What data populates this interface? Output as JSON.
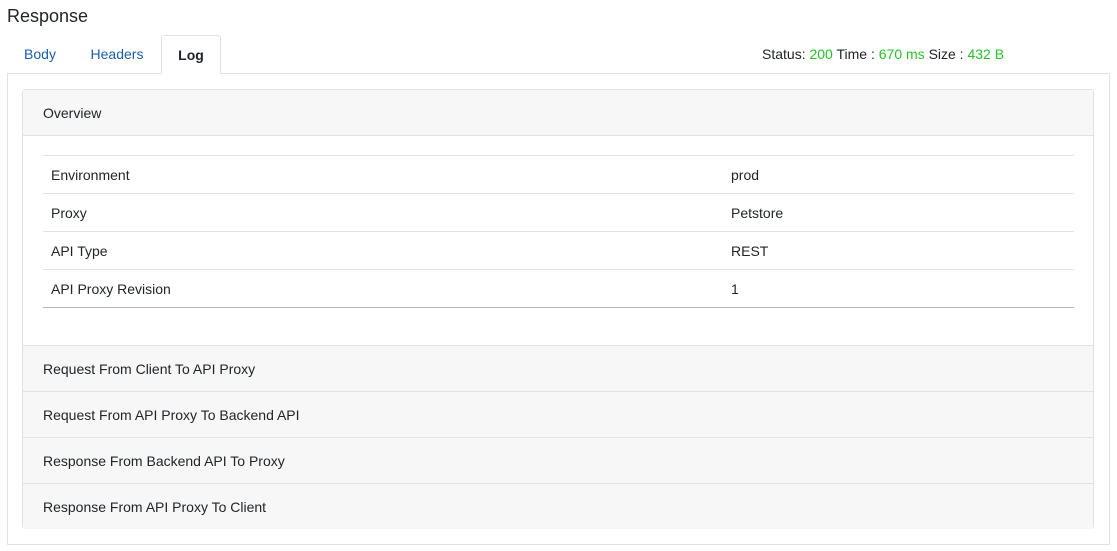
{
  "title": "Response",
  "tabs": [
    {
      "label": "Body"
    },
    {
      "label": "Headers"
    },
    {
      "label": "Log"
    }
  ],
  "active_tab": "Log",
  "status_bar": {
    "status_label": "Status:",
    "status_value": "200",
    "time_label": "Time :",
    "time_value": "670 ms",
    "size_label": "Size :",
    "size_value": "432 B"
  },
  "overview": {
    "header": "Overview",
    "rows": [
      {
        "key": "Environment",
        "value": "prod"
      },
      {
        "key": "Proxy",
        "value": "Petstore"
      },
      {
        "key": "API Type",
        "value": "REST"
      },
      {
        "key": "API Proxy Revision",
        "value": "1"
      }
    ]
  },
  "sections": [
    {
      "label": "Request From Client To API Proxy"
    },
    {
      "label": "Request From API Proxy To Backend API"
    },
    {
      "label": "Response From Backend API To Proxy"
    },
    {
      "label": "Response From API Proxy To Client"
    }
  ],
  "colors": {
    "ok": "#28c128",
    "link": "#1a5fa8",
    "border": "#dee2e6",
    "header_bg": "#f7f7f7"
  }
}
